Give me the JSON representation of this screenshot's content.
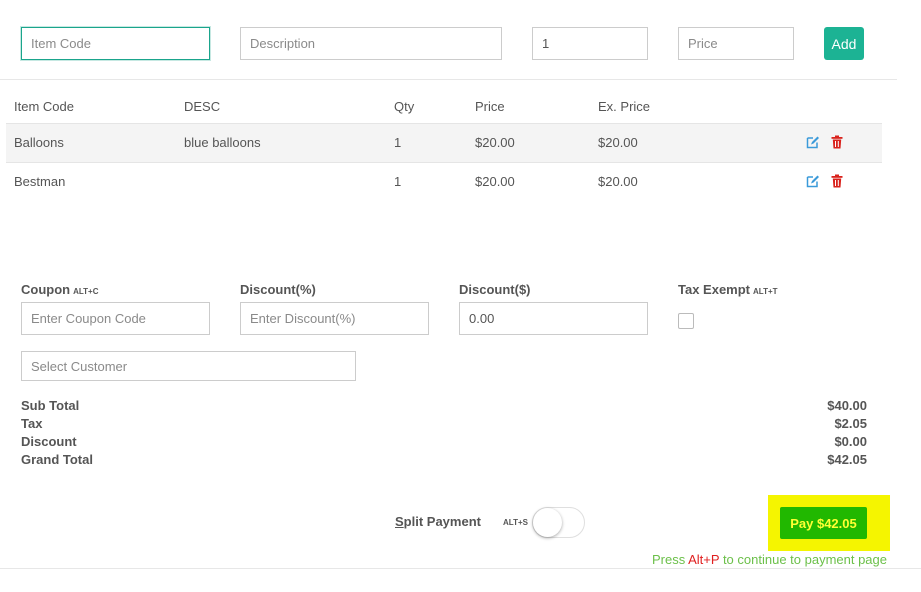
{
  "entry": {
    "item_code_placeholder": "Item Code",
    "description_placeholder": "Description",
    "qty_value": "1",
    "price_placeholder": "Price",
    "add_label": "Add"
  },
  "table": {
    "headers": [
      "Item Code",
      "DESC",
      "Qty",
      "Price",
      "Ex. Price"
    ],
    "rows": [
      {
        "item_code": "Balloons",
        "desc": "blue balloons",
        "qty": "1",
        "price": "$20.00",
        "ex_price": "$20.00"
      },
      {
        "item_code": "Bestman",
        "desc": "",
        "qty": "1",
        "price": "$20.00",
        "ex_price": "$20.00"
      }
    ],
    "row_icons": [
      "edit-icon",
      "trash-icon"
    ]
  },
  "options": {
    "coupon_label": "Coupon",
    "coupon_hint": "ALT+C",
    "coupon_placeholder": "Enter Coupon Code",
    "discount_pct_label": "Discount(%)",
    "discount_pct_placeholder": "Enter Discount(%)",
    "discount_amt_label": "Discount($)",
    "discount_amt_value": "0.00",
    "tax_exempt_label": "Tax Exempt",
    "tax_exempt_hint": "ALT+T",
    "tax_exempt_checked": false,
    "customer_placeholder": "Select Customer"
  },
  "summary": {
    "subtotal_label": "Sub Total",
    "subtotal_value": "$40.00",
    "tax_label": "Tax",
    "tax_value": "$2.05",
    "discount_label": "Discount",
    "discount_value": "$0.00",
    "grand_total_label": "Grand Total",
    "grand_total_value": "$42.05"
  },
  "payment": {
    "split_first_letter": "S",
    "split_rest": "plit Payment",
    "split_hint": "ALT+S",
    "split_enabled": false,
    "pay_label": "Pay $42.05",
    "note_prefix": "Press ",
    "note_key": "Alt+P",
    "note_suffix": " to continue to payment page"
  },
  "colors": {
    "accent": "#1cb394",
    "edit_icon": "#3a9ad9",
    "trash_icon": "#d9221c",
    "pay_button": "#21b800",
    "pay_text": "#ffff33",
    "highlight": "#f5f500",
    "note_text": "#6cc04a",
    "note_key": "#e02020"
  }
}
